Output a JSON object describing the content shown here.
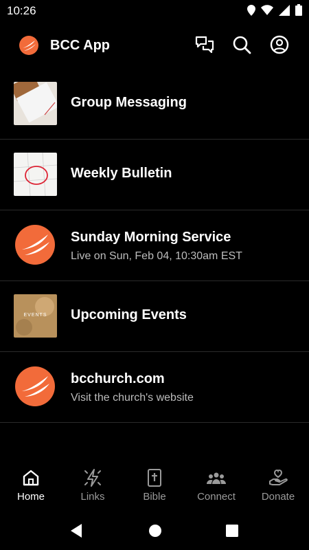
{
  "status": {
    "time": "10:26"
  },
  "appbar": {
    "title": "BCC App"
  },
  "items": [
    {
      "title": "Group Messaging"
    },
    {
      "title": "Weekly Bulletin"
    },
    {
      "title": "Sunday Morning Service",
      "subtitle": "Live on Sun, Feb 04, 10:30am EST"
    },
    {
      "title": "Upcoming Events",
      "thumb_text": "EVENTS"
    },
    {
      "title": "bcchurch.com",
      "subtitle": "Visit the church's website"
    }
  ],
  "tabs": [
    {
      "label": "Home",
      "icon": "home-icon",
      "active": true
    },
    {
      "label": "Links",
      "icon": "links-icon"
    },
    {
      "label": "Bible",
      "icon": "bible-icon"
    },
    {
      "label": "Connect",
      "icon": "connect-icon"
    },
    {
      "label": "Donate",
      "icon": "donate-icon"
    }
  ],
  "colors": {
    "accent": "#F26B3A",
    "background": "#000000",
    "inactive": "#9A9A9A"
  }
}
